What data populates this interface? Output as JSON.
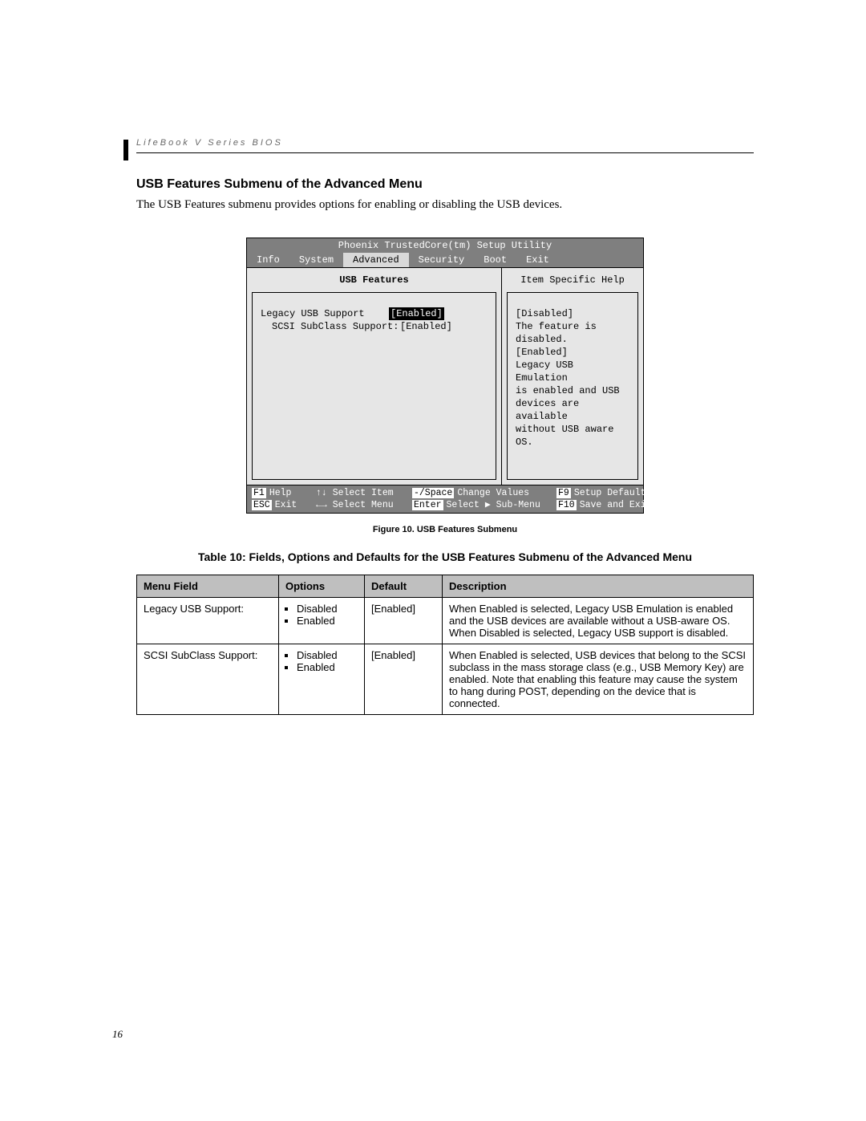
{
  "header": "LifeBook V Series BIOS",
  "section_title": "USB Features Submenu of the Advanced Menu",
  "intro_text": "The USB Features submenu provides options for enabling or disabling the USB devices.",
  "bios": {
    "window_title": "Phoenix TrustedCore(tm) Setup Utility",
    "tabs": [
      "Info",
      "System",
      "Advanced",
      "Security",
      "Boot",
      "Exit"
    ],
    "active_tab_index": 2,
    "left_title": "USB Features",
    "right_title": "Item Specific Help",
    "items": [
      {
        "label": "Legacy USB Support",
        "value": "[Enabled]",
        "selected": true,
        "indent": 0
      },
      {
        "label": "SCSI SubClass Support:",
        "value": "[Enabled]",
        "selected": false,
        "indent": 1
      }
    ],
    "help_lines": [
      "[Disabled]",
      "The feature is disabled.",
      "",
      "[Enabled]",
      "Legacy USB Emulation",
      "is enabled and USB",
      "devices are available",
      "without USB aware OS."
    ],
    "footer": {
      "line1": {
        "k1": "F1",
        "t1": "Help",
        "a2": "↑↓",
        "t2": "Select Item",
        "k3": "-/Space",
        "t3": "Change Values",
        "k4": "F9",
        "t4": "Setup Defaults"
      },
      "line2": {
        "k1": "ESC",
        "t1": "Exit",
        "a2": "←→",
        "t2": "Select Menu",
        "k3": "Enter",
        "t3": "Select ▶ Sub-Menu",
        "k4": "F10",
        "t4": "Save and Exit"
      }
    }
  },
  "figure_caption": "Figure 10.  USB Features Submenu",
  "table_title": "Table 10: Fields, Options and Defaults for the USB Features Submenu of the Advanced Menu",
  "table": {
    "headers": [
      "Menu Field",
      "Options",
      "Default",
      "Description"
    ],
    "rows": [
      {
        "field": "Legacy USB Support:",
        "options": [
          "Disabled",
          "Enabled"
        ],
        "default": "[Enabled]",
        "description": "When Enabled is selected, Legacy USB Emulation is enabled and the USB devices are available without a USB-aware OS. When Disabled is selected, Legacy USB support is disabled."
      },
      {
        "field": "SCSI SubClass Support:",
        "options": [
          "Disabled",
          "Enabled"
        ],
        "default": "[Enabled]",
        "description": "When Enabled is selected, USB devices that belong to the SCSI subclass in the mass storage class (e.g., USB Memory Key) are enabled. Note that enabling this feature may cause the system to hang during POST, depending on the device that is connected."
      }
    ]
  },
  "page_number": "16"
}
